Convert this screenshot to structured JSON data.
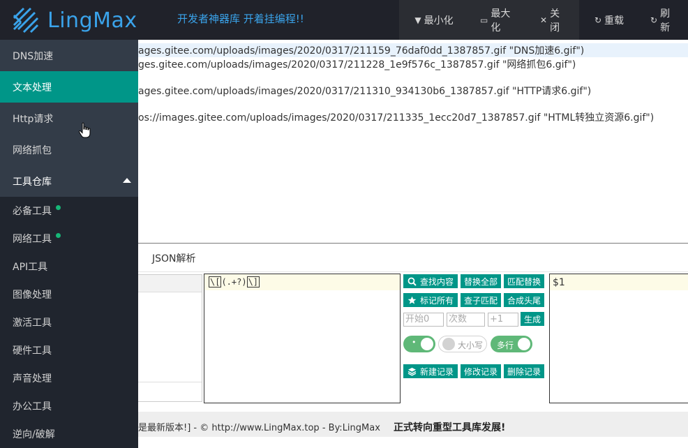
{
  "header": {
    "logo_text": "LingMax",
    "slogan": "开发者神器库 开着挂编程!!",
    "buttons": [
      {
        "label": "最小化"
      },
      {
        "label": "最大化"
      },
      {
        "label": "关闭"
      },
      {
        "label": "重载"
      },
      {
        "label": "刷新"
      }
    ]
  },
  "sidebar": {
    "items": [
      {
        "label": "DNS加速"
      },
      {
        "label": "文本处理"
      },
      {
        "label": "Http请求"
      },
      {
        "label": "网络抓包"
      }
    ],
    "group": {
      "label": "工具仓库"
    },
    "sub_items": [
      {
        "label": "必备工具"
      },
      {
        "label": "网络工具"
      },
      {
        "label": "API工具"
      },
      {
        "label": "图像处理"
      },
      {
        "label": "激活工具"
      },
      {
        "label": "硬件工具"
      },
      {
        "label": "声音处理"
      },
      {
        "label": "办公工具"
      },
      {
        "label": "逆向/破解"
      }
    ]
  },
  "text_lines": [
    "ages.gitee.com/uploads/images/2020/0317/211159_76daf0dd_1387857.gif \"DNS加速6.gif\")",
    "ges.gitee.com/uploads/images/2020/0317/211228_1e9f576c_1387857.gif \"网络抓包6.gif\")",
    "ages.gitee.com/uploads/images/2020/0317/211310_934130b6_1387857.gif \"HTTP请求6.gif\")",
    "os://images.gitee.com/uploads/images/2020/0317/211335_1ecc20d7_1387857.gif \"HTML转独立资源6.gif\")"
  ],
  "tabs": [
    {
      "label": "JSON解析"
    }
  ],
  "regex": {
    "open": "\\[",
    "pattern": "(.+?)",
    "close": "\\]"
  },
  "replace_value": "$1",
  "controls": {
    "find_button": "查找内容",
    "replace_all_button": "替换全部",
    "match_replace_button": "匹配替换",
    "mark_all_button": "标记所有",
    "sub_match_button": "查子匹配",
    "merge_button": "合成头尾",
    "start_placeholder": "开始0",
    "count_placeholder": "次数",
    "step_placeholder": "+1",
    "generate_button": "生成",
    "toggle_case_label": "大小写",
    "toggle_multiline_label": "多行",
    "new_record_button": "新建记录",
    "edit_record_button": "修改记录",
    "delete_record_button": "删除记录"
  },
  "footer": {
    "text": "是最新版本!] - © http://www.LingMax.top - By:LingMax",
    "bold_text": "正式转向重型工具库发展!"
  }
}
